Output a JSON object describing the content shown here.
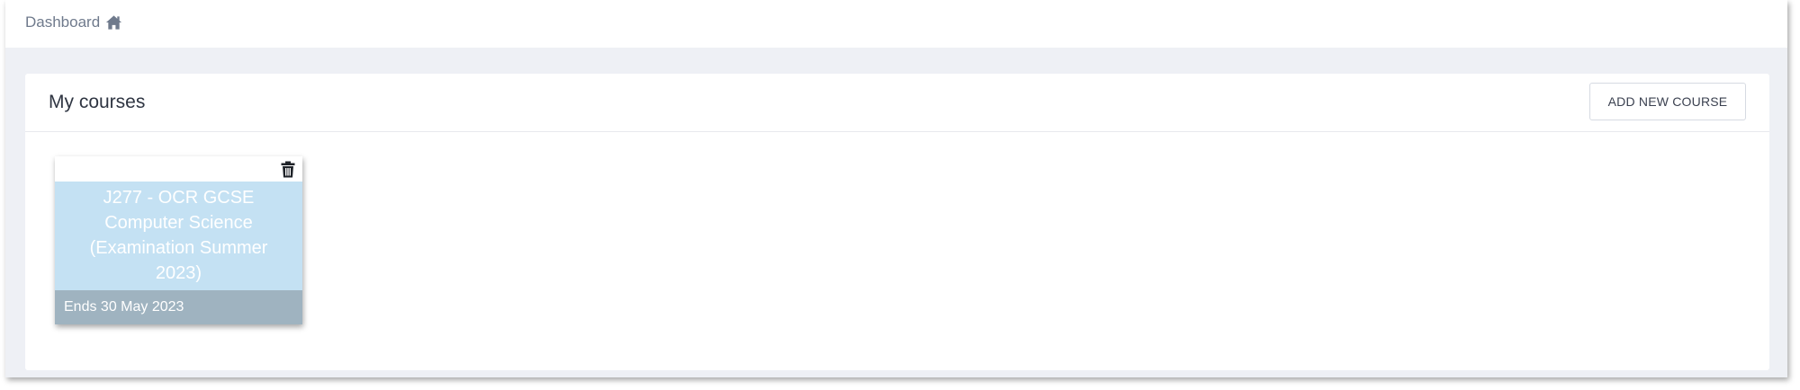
{
  "breadcrumb": {
    "label": "Dashboard",
    "icon": "home-icon"
  },
  "panel": {
    "title": "My courses",
    "add_button_label": "ADD NEW COURSE"
  },
  "courses": [
    {
      "title": "J277 - OCR GCSE Computer Science (Examination Summer 2023)",
      "end_text": "Ends 30 May 2023",
      "color": "#c4e1f3",
      "delete_icon": "trash-icon"
    }
  ],
  "colors": {
    "page_background": "#eef0f5",
    "breadcrumb_text": "#6f7a8c",
    "card_background": "#c4e1f3",
    "card_footer": "#9fb3c0"
  }
}
